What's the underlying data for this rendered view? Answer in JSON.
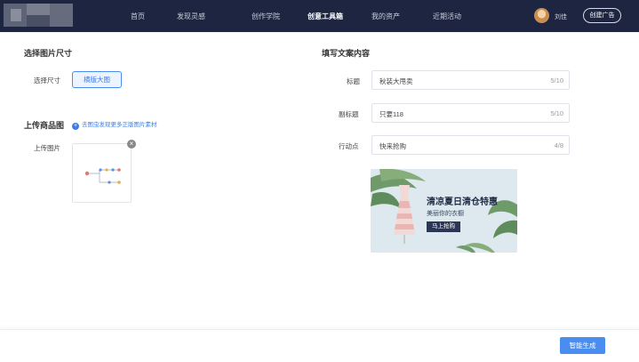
{
  "nav": {
    "items": [
      {
        "label": "首页",
        "active": false
      },
      {
        "label": "发现灵感",
        "active": false
      },
      {
        "label": "创作学院",
        "active": false
      },
      {
        "label": "创意工具箱",
        "active": true
      },
      {
        "label": "我的资产",
        "active": false
      },
      {
        "label": "近期活动",
        "active": false
      }
    ],
    "user_name": "刘佳",
    "create_ad_label": "创建广告"
  },
  "left": {
    "size_section_title": "选择图片尺寸",
    "size_label": "选择尺寸",
    "size_option": "横版大图",
    "upload_section_title": "上传商品图",
    "upload_hint": "去图虫发现更多正版图片素材",
    "upload_label": "上传图片"
  },
  "right": {
    "copy_section_title": "填写文案内容",
    "fields": [
      {
        "label": "标题",
        "value": "秋装大甩卖",
        "count": "5/10"
      },
      {
        "label": "副标题",
        "value": "只要118",
        "count": "5/10"
      },
      {
        "label": "行动点",
        "value": "快来抢购",
        "count": "4/8"
      }
    ],
    "preview": {
      "title": "清凉夏日清仓特惠",
      "subtitle": "美丽你的衣橱",
      "button": "马上抢购"
    }
  },
  "footer": {
    "generate_label": "智能生成"
  },
  "colors": {
    "nav_bg": "#1d2540",
    "accent": "#4a8df0"
  }
}
